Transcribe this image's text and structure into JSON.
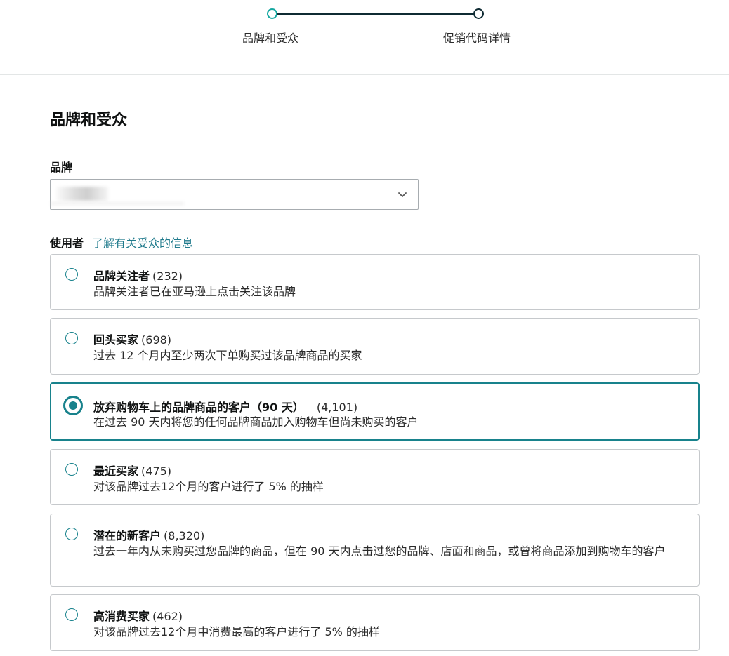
{
  "stepper": {
    "steps": [
      {
        "label": "品牌和受众",
        "state": "active"
      },
      {
        "label": "促销代码详情",
        "state": "inactive"
      }
    ],
    "colors": {
      "active": "#14a7a0",
      "inactive": "#0f2b33"
    }
  },
  "section": {
    "title": "品牌和受众"
  },
  "brand": {
    "label": "品牌",
    "selected_value": ""
  },
  "audience": {
    "label": "使用者",
    "learn_link": "了解有关受众的信息",
    "options": [
      {
        "name": "品牌关注者",
        "count": "(232)",
        "desc": "品牌关注者已在亚马逊上点击关注该品牌",
        "selected": false
      },
      {
        "name": "回头买家",
        "count": "(698)",
        "desc": "过去 12 个月内至少两次下单购买过该品牌商品的买家",
        "selected": false
      },
      {
        "name": "放弃购物车上的品牌商品的客户（90 天）",
        "count": "(4,101)",
        "desc": "在过去 90 天内将您的任何品牌商品加入购物车但尚未购买的客户",
        "selected": true
      },
      {
        "name": "最近买家",
        "count": "(475)",
        "desc": "对该品牌过去12个月的客户进行了 5% 的抽样",
        "selected": false
      },
      {
        "name": "潜在的新客户",
        "count": "(8,320)",
        "desc": "过去一年内从未购买过您品牌的商品，但在 90 天内点击过您的品牌、店面和商品，或曾将商品添加到购物车的客户",
        "selected": false
      },
      {
        "name": "高消费买家",
        "count": "(462)",
        "desc": "对该品牌过去12个月中消费最高的客户进行了 5% 的抽样",
        "selected": false
      }
    ]
  },
  "colors": {
    "accent": "#18828c",
    "link": "#1f7a8c",
    "border": "#c6c9cc"
  }
}
